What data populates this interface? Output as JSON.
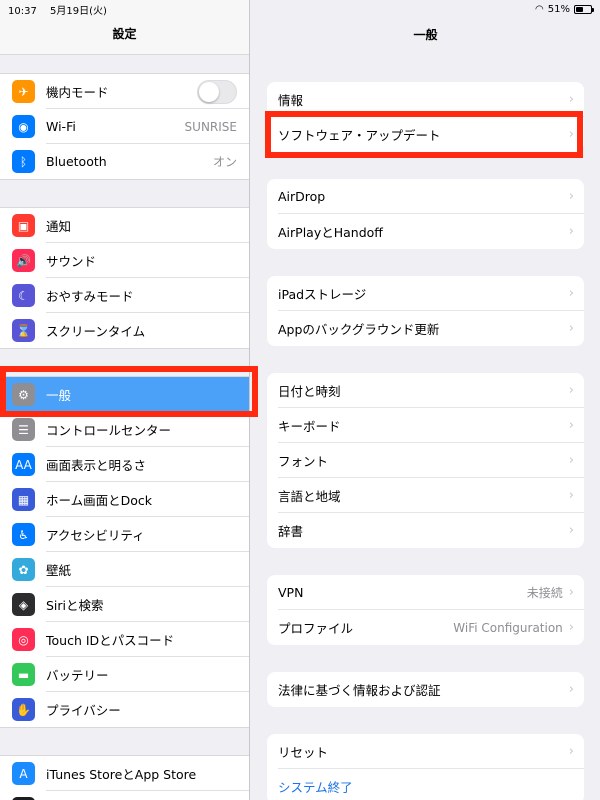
{
  "status": {
    "time": "10:37",
    "date": "5月19日(火)",
    "battery": "51%",
    "battery_fill": 0.51
  },
  "left": {
    "title": "設定",
    "groups": [
      [
        {
          "label": "機内モード",
          "icon": "airplane-icon",
          "color": "#ff9500",
          "glyph": "✈",
          "toggle": false
        },
        {
          "label": "Wi-Fi",
          "icon": "wifi-icon",
          "color": "#007aff",
          "glyph": "◉",
          "value": "SUNRISE"
        },
        {
          "label": "Bluetooth",
          "icon": "bluetooth-icon",
          "color": "#007aff",
          "glyph": "ᛒ",
          "value": "オン"
        }
      ],
      [
        {
          "label": "通知",
          "icon": "notifications-icon",
          "color": "#ff3b30",
          "glyph": "▣"
        },
        {
          "label": "サウンド",
          "icon": "sound-icon",
          "color": "#ff2d55",
          "glyph": "🔊"
        },
        {
          "label": "おやすみモード",
          "icon": "moon-icon",
          "color": "#5856d6",
          "glyph": "☾"
        },
        {
          "label": "スクリーンタイム",
          "icon": "hourglass-icon",
          "color": "#5856d6",
          "glyph": "⌛"
        }
      ],
      [
        {
          "label": "一般",
          "icon": "gear-icon",
          "color": "#8e8e93",
          "glyph": "⚙",
          "selected": true
        },
        {
          "label": "コントロールセンター",
          "icon": "switches-icon",
          "color": "#8e8e93",
          "glyph": "☰"
        },
        {
          "label": "画面表示と明るさ",
          "icon": "display-icon",
          "color": "#007aff",
          "glyph": "AA"
        },
        {
          "label": "ホーム画面とDock",
          "icon": "home-grid-icon",
          "color": "#3a5bd9",
          "glyph": "▦"
        },
        {
          "label": "アクセシビリティ",
          "icon": "accessibility-icon",
          "color": "#007aff",
          "glyph": "♿"
        },
        {
          "label": "壁紙",
          "icon": "wallpaper-icon",
          "color": "#34aadc",
          "glyph": "✿"
        },
        {
          "label": "Siriと検索",
          "icon": "siri-icon",
          "color": "#2c2c2e",
          "glyph": "◈"
        },
        {
          "label": "Touch IDとパスコード",
          "icon": "fingerprint-icon",
          "color": "#ff2d55",
          "glyph": "◎"
        },
        {
          "label": "バッテリー",
          "icon": "battery-icon",
          "color": "#34c759",
          "glyph": "▬"
        },
        {
          "label": "プライバシー",
          "icon": "hand-icon",
          "color": "#3a5bd9",
          "glyph": "✋"
        }
      ],
      [
        {
          "label": "iTunes StoreとApp Store",
          "icon": "appstore-icon",
          "color": "#1a8cff",
          "glyph": "A"
        },
        {
          "label": "",
          "icon": "wallet-icon",
          "color": "#1c1c1e",
          "glyph": ""
        }
      ]
    ]
  },
  "right": {
    "title": "一般",
    "groups": [
      [
        {
          "label": "情報"
        },
        {
          "label": "ソフトウェア・アップデート"
        }
      ],
      [
        {
          "label": "AirDrop"
        },
        {
          "label": "AirPlayとHandoff"
        }
      ],
      [
        {
          "label": "iPadストレージ"
        },
        {
          "label": "Appのバックグラウンド更新"
        }
      ],
      [
        {
          "label": "日付と時刻"
        },
        {
          "label": "キーボード"
        },
        {
          "label": "フォント"
        },
        {
          "label": "言語と地域"
        },
        {
          "label": "辞書"
        }
      ],
      [
        {
          "label": "VPN",
          "value": "未接続"
        },
        {
          "label": "プロファイル",
          "value": "WiFi Configuration"
        }
      ],
      [
        {
          "label": "法律に基づく情報および認証"
        }
      ],
      [
        {
          "label": "リセット"
        },
        {
          "label": "システム終了",
          "link": true,
          "nochev": true
        }
      ]
    ]
  },
  "colors": {
    "highlight": "#ff2a0f",
    "selected": "#4aa1f7"
  }
}
